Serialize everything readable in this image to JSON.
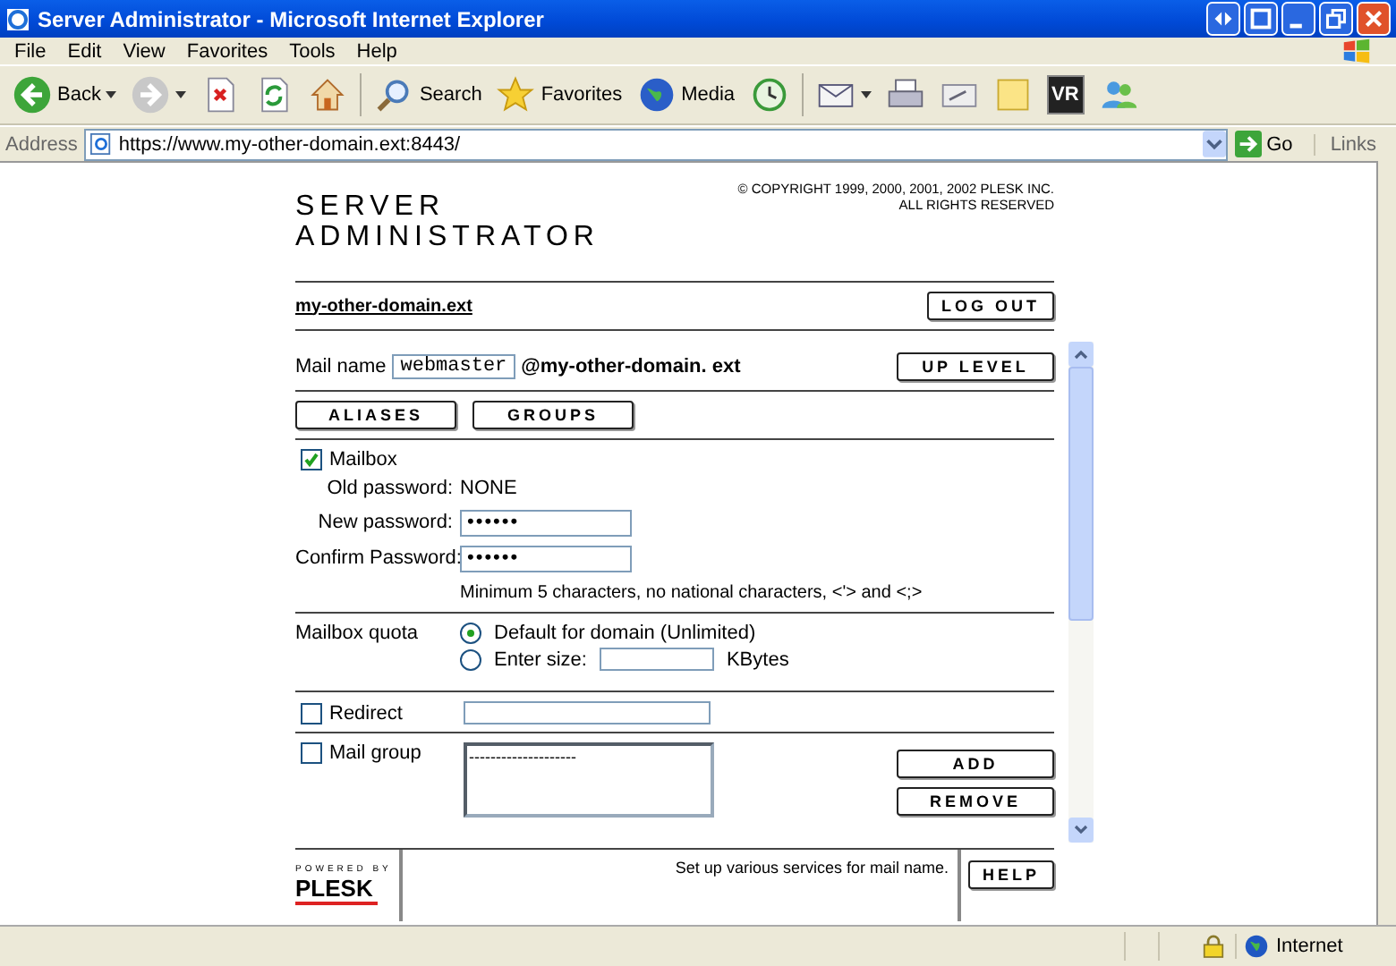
{
  "window": {
    "title": "Server Administrator - Microsoft Internet Explorer"
  },
  "menu": [
    "File",
    "Edit",
    "View",
    "Favorites",
    "Tools",
    "Help"
  ],
  "toolbar": [
    {
      "kind": "back",
      "label": "Back"
    },
    {
      "kind": "forward"
    },
    {
      "kind": "stop"
    },
    {
      "kind": "refresh"
    },
    {
      "kind": "home"
    },
    {
      "kind": "search",
      "label": "Search"
    },
    {
      "kind": "favorites",
      "label": "Favorites"
    },
    {
      "kind": "media",
      "label": "Media"
    },
    {
      "kind": "history"
    },
    {
      "kind": "mail"
    },
    {
      "kind": "print"
    },
    {
      "kind": "edit"
    },
    {
      "kind": "note"
    },
    {
      "kind": "vr",
      "label": "VR"
    },
    {
      "kind": "messenger"
    }
  ],
  "address": {
    "label": "Address",
    "url": "https://www.my-other-domain.ext:8443/",
    "go": "Go",
    "links": "Links"
  },
  "page": {
    "title_lines": [
      "SERVER",
      "ADMINISTRATOR"
    ],
    "copyright": [
      "© COPYRIGHT 1999, 2000, 2001, 2002 PLESK INC.",
      "ALL RIGHTS RESERVED"
    ],
    "domain_link": "my-other-domain.ext",
    "logout": "LOG OUT"
  },
  "form": {
    "mail_name_label": "Mail name",
    "mail_name": "webmaster",
    "domain": "@my-other-domain. ext",
    "up_level": "UP LEVEL",
    "tabs": [
      "ALIASES",
      "GROUPS"
    ],
    "mailbox": {
      "label": "Mailbox",
      "checked": true,
      "fields": [
        {
          "label": "Old password:",
          "kind": "text",
          "value": "NONE"
        },
        {
          "label": "New password:",
          "kind": "password",
          "value": "••••••"
        },
        {
          "label": "Confirm Password:",
          "kind": "password",
          "value": "••••••"
        }
      ],
      "hint": "Minimum 5 characters, no national characters, <'> and <;>"
    },
    "quota": {
      "label": "Mailbox quota",
      "options": [
        {
          "label": "Default for domain (Unlimited)",
          "selected": true
        },
        {
          "label": "Enter size:",
          "selected": false,
          "unit": "KBytes"
        }
      ]
    },
    "redirect": {
      "label": "Redirect",
      "checked": false
    },
    "mail_group": {
      "label": "Mail group",
      "checked": false,
      "list": [
        "--------------------"
      ],
      "buttons": [
        "ADD",
        "REMOVE"
      ]
    }
  },
  "footer": {
    "powered": "POWERED BY",
    "logo": "PLESK",
    "message": "Set up various services for mail name.",
    "help": "HELP"
  },
  "status_bar": {
    "zone": "Internet"
  }
}
